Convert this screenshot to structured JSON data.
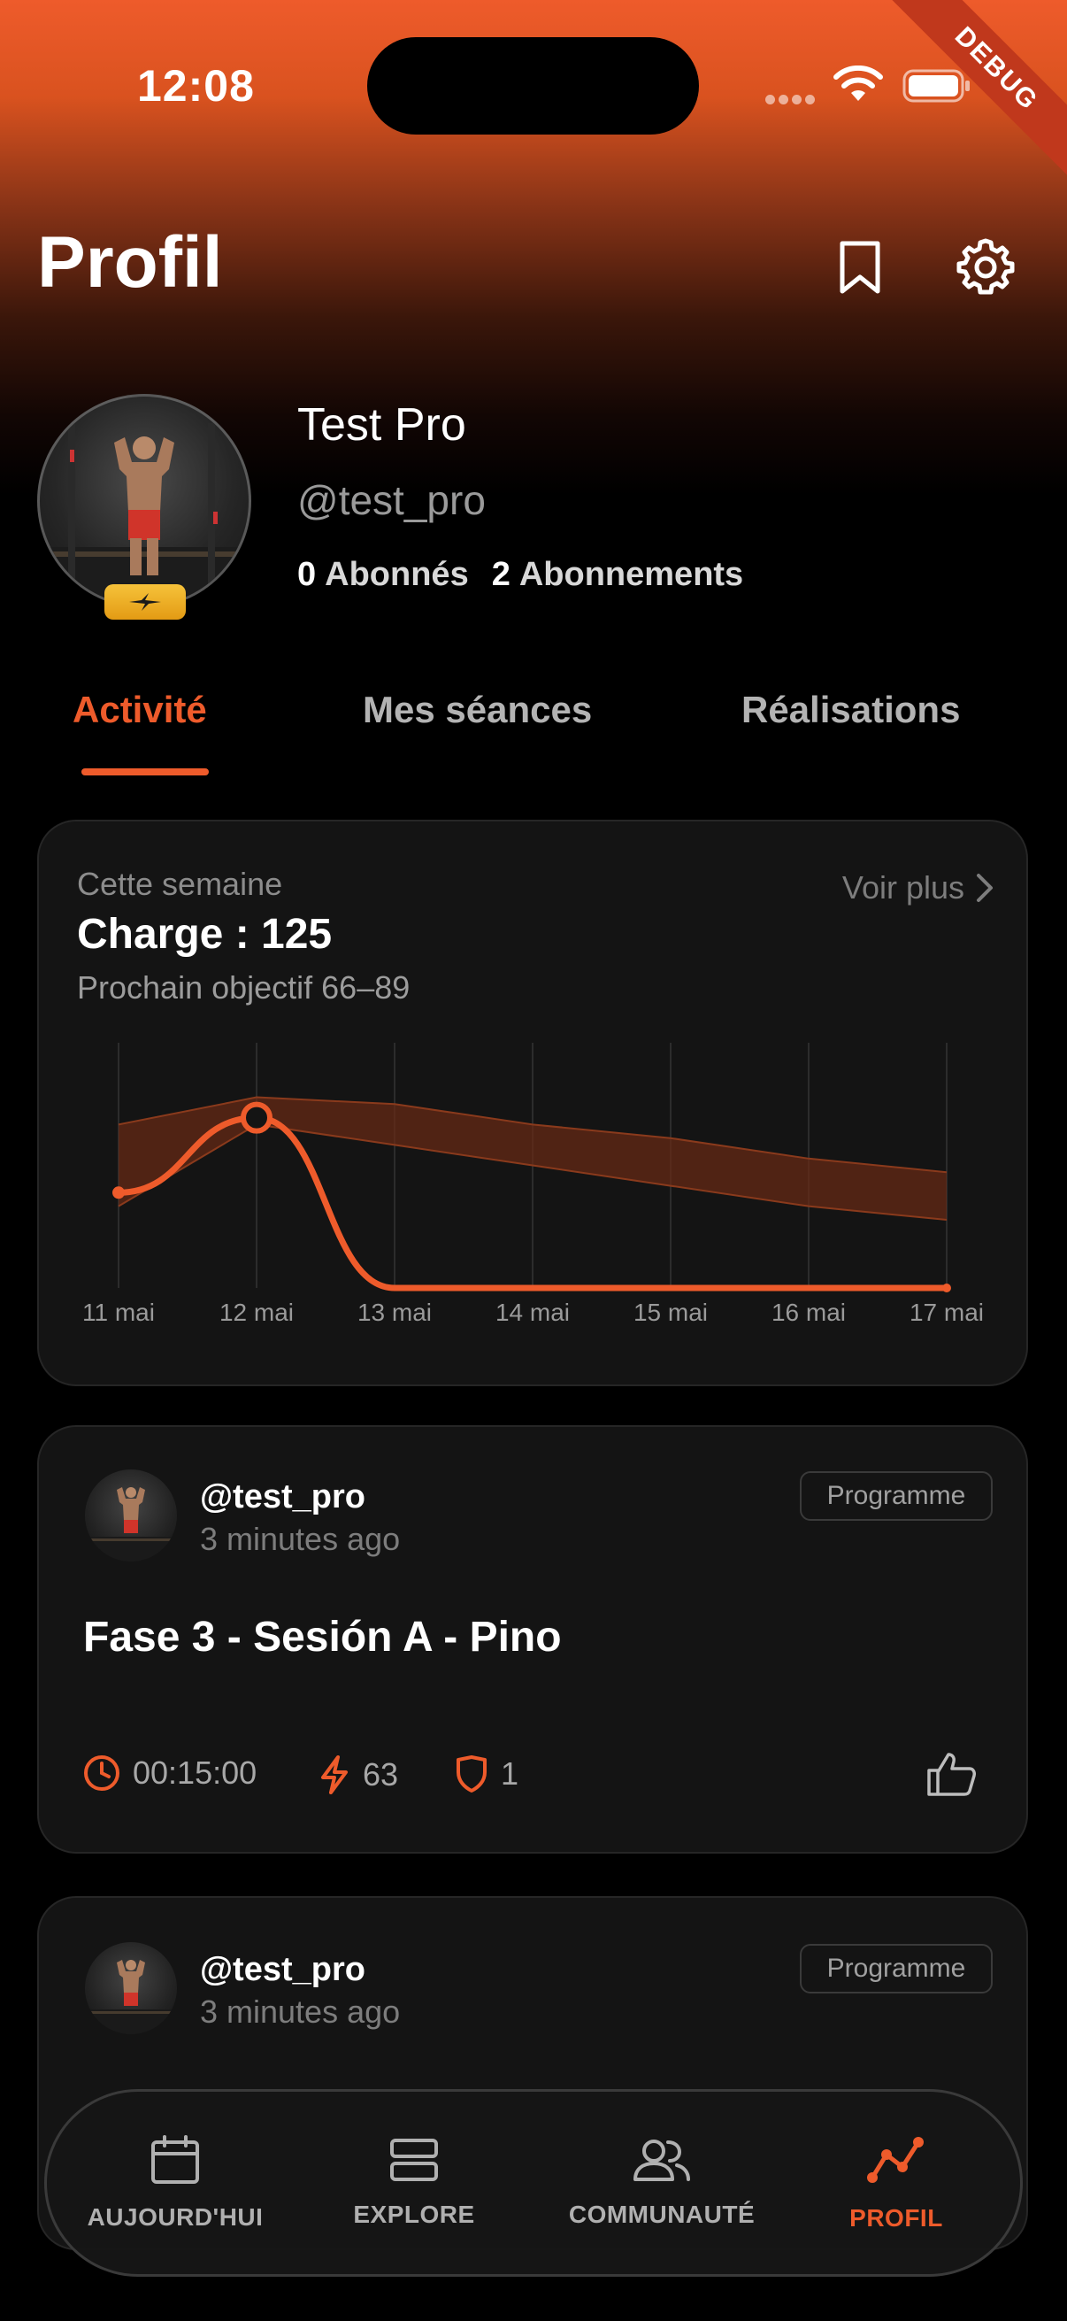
{
  "status_bar": {
    "time": "12:08",
    "debug_banner": "DEBUG"
  },
  "header": {
    "title": "Profil",
    "icons": [
      "bookmark-icon",
      "gear-icon"
    ]
  },
  "profile": {
    "display_name": "Test Pro",
    "handle": "@test_pro",
    "followers_count": "0",
    "followers_label": "Abonnés",
    "following_count": "2",
    "following_label": "Abonnements"
  },
  "tabs": [
    {
      "label": "Activité",
      "active": true
    },
    {
      "label": "Mes séances",
      "active": false
    },
    {
      "label": "Réalisations",
      "active": false
    }
  ],
  "activity_card": {
    "week_label": "Cette semaine",
    "charge_label": "Charge : 125",
    "next_goal": "Prochain objectif 66–89",
    "see_more": "Voir plus"
  },
  "chart_data": {
    "type": "line",
    "categories": [
      "11 mai",
      "12 mai",
      "13 mai",
      "14 mai",
      "15 mai",
      "16 mai",
      "17 mai"
    ],
    "series": [
      {
        "values": [
          70,
          125,
          0,
          0,
          0,
          0,
          0
        ]
      }
    ],
    "band_upper": [
      120,
      140,
      135,
      120,
      110,
      95,
      85
    ],
    "band_lower": [
      60,
      120,
      105,
      90,
      75,
      60,
      50
    ],
    "highlighted_index": 1,
    "ylim": [
      0,
      180
    ],
    "grid": "vertical",
    "line_color": "#ee5b2b",
    "band_color": "#6a2a14"
  },
  "posts": [
    {
      "user": "@test_pro",
      "time": "3 minutes ago",
      "tag": "Programme",
      "title": "Fase 3 - Sesión A - Pino",
      "duration": "00:15:00",
      "load": "63",
      "count": "1"
    },
    {
      "user": "@test_pro",
      "time": "3 minutes ago",
      "tag": "Programme"
    }
  ],
  "bottom_nav": [
    {
      "label": "AUJOURD'HUI",
      "icon": "calendar-icon",
      "active": false
    },
    {
      "label": "EXPLORE",
      "icon": "layers-icon",
      "active": false
    },
    {
      "label": "COMMUNAUTÉ",
      "icon": "users-icon",
      "active": false
    },
    {
      "label": "PROFIL",
      "icon": "trend-icon",
      "active": true
    }
  ],
  "colors": {
    "accent": "#ee5b2b",
    "card": "#141414",
    "background": "#000000"
  }
}
